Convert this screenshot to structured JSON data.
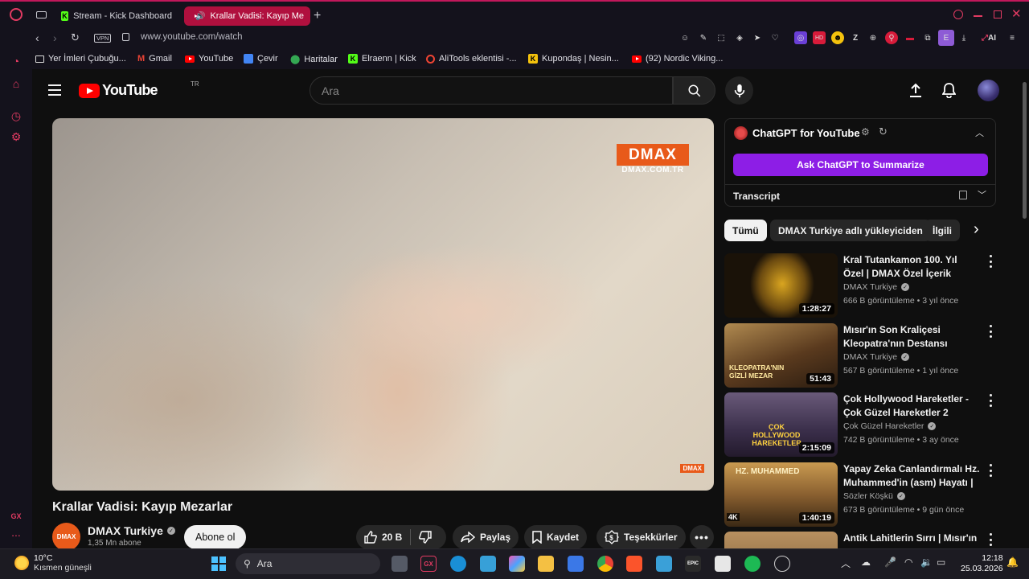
{
  "browser": {
    "tabs": [
      {
        "label": "Stream - Kick Dashboard",
        "active": false
      },
      {
        "label": "Krallar Vadisi: Kayıp Me",
        "active": true
      }
    ],
    "new_tab": "+",
    "vpn_label": "VPN",
    "url": "www.youtube.com/watch",
    "bookmarks": [
      "Yer İmleri Çubuğu...",
      "Gmail",
      "YouTube",
      "Çevir",
      "Haritalar",
      "Elraenn | Kick",
      "AliTools eklentisi -...",
      "Kupondaş | Nesin...",
      "(92) Nordic Viking..."
    ],
    "ext_ai_label": "AI",
    "ext_e_label": "E",
    "sidebar_gx": "GX",
    "sidebar_more": "..."
  },
  "youtube": {
    "logo_text": "YouTube",
    "country_code": "TR",
    "search_placeholder": "Ara",
    "video": {
      "title": "Krallar Vadisi: Kayıp Mezarlar",
      "watermark_top": "DMAX",
      "watermark_bottom": "DMAX.COM.TR",
      "watermark_small": "DMAX"
    },
    "channel": {
      "name": "DMAX Turkiye",
      "subscribers": "1,35 Mn abone",
      "avatar_text": "DMAX"
    },
    "subscribe_label": "Abone ol",
    "actions": {
      "likes": "20 B",
      "share": "Paylaş",
      "save": "Kaydet",
      "thanks": "Teşekkürler"
    },
    "chatgpt": {
      "title": "ChatGPT for YouTube",
      "button": "Ask ChatGPT to Summarize",
      "transcript": "Transcript"
    },
    "chips": [
      "Tümü",
      "DMAX Turkiye adlı yükleyiciden",
      "İlgili"
    ],
    "recommendations": [
      {
        "title": "Kral Tutankamon 100. Yıl Özel | DMAX Özel İçerik",
        "channel": "DMAX Turkiye",
        "meta": "666 B görüntüleme • 3 yıl önce",
        "duration": "1:28:27",
        "thumb_color": "#2a1f0c"
      },
      {
        "title": "Mısır'ın Son Kraliçesi Kleopatra'nın Destansı Hikaye...",
        "channel": "DMAX Turkiye",
        "meta": "567 B görüntüleme • 1 yıl önce",
        "duration": "51:43",
        "thumb_color": "#6b4a24",
        "thumb_text": "KLEOPATRA'NIN GİZLİ MEZAR"
      },
      {
        "title": "Çok Hollywood Hareketler - Çok Güzel Hareketler 2",
        "channel": "Çok Güzel Hareketler",
        "meta": "742 B görüntüleme • 3 ay önce",
        "duration": "2:15:09",
        "thumb_color": "#4a3a5a",
        "thumb_text": "ÇOK HOLLYWOOD HAREKETLER"
      },
      {
        "title": "Yapay Zeka Canlandırmalı Hz. Muhammed'in (asm) Hayatı | ...",
        "channel": "Sözler Köşkü",
        "meta": "673 B görüntüleme • 9 gün önce",
        "duration": "1:40:19",
        "thumb_color": "#7a5a30",
        "thumb_text": "HZ. MUHAMMED",
        "badge": "4K"
      },
      {
        "title": "Antik Lahitlerin Sırrı | Mısır'ın",
        "channel": "",
        "meta": "",
        "duration": "",
        "thumb_color": "#8a6a40"
      }
    ]
  },
  "taskbar": {
    "temperature": "10°C",
    "weather_desc": "Kısmen güneşli",
    "search_label": "Ara",
    "time": "12:18",
    "date": "25.03.2026"
  },
  "colors": {
    "accent_opera": "#e23b62",
    "youtube_red": "#ff0000",
    "chatgpt_purple": "#8d1ee6",
    "dmax_orange": "#e85a1a"
  }
}
